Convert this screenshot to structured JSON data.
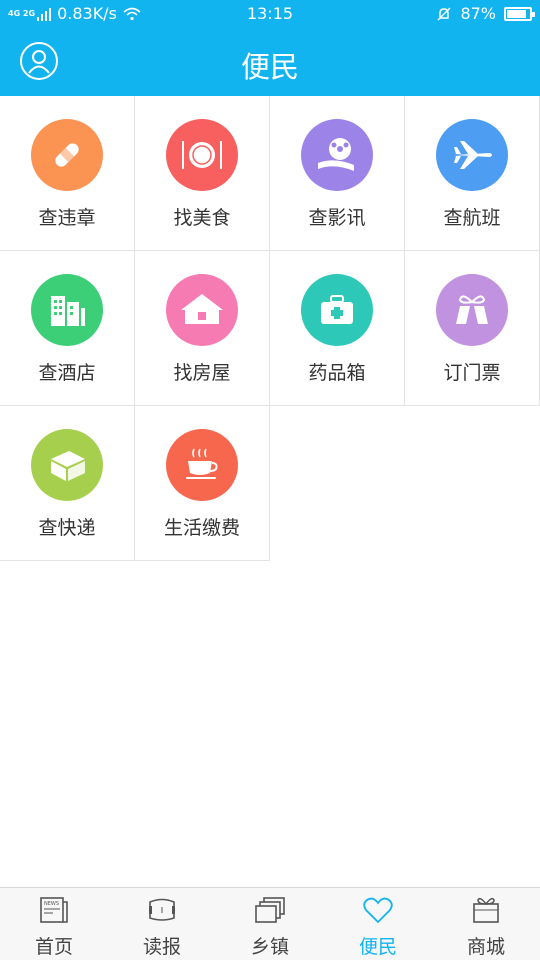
{
  "status_bar": {
    "network": "4G 2G",
    "speed": "0.83K/s",
    "time": "13:15",
    "battery": "87%",
    "battery_level": 0.87
  },
  "header": {
    "title": "便民"
  },
  "services": [
    {
      "label": "查违章",
      "icon": "bandage-icon",
      "color": "#fb9352"
    },
    {
      "label": "找美食",
      "icon": "dining-plate-icon",
      "color": "#f85f5f"
    },
    {
      "label": "查影讯",
      "icon": "film-reel-icon",
      "color": "#9b83e8"
    },
    {
      "label": "查航班",
      "icon": "airplane-icon",
      "color": "#4d9df2"
    },
    {
      "label": "查酒店",
      "icon": "hotel-building-icon",
      "color": "#3ccf78"
    },
    {
      "label": "找房屋",
      "icon": "house-icon",
      "color": "#f67bb3"
    },
    {
      "label": "药品箱",
      "icon": "medicine-box-icon",
      "color": "#2ec8b8"
    },
    {
      "label": "订门票",
      "icon": "ticket-gift-icon",
      "color": "#c192e0"
    },
    {
      "label": "查快递",
      "icon": "parcel-box-icon",
      "color": "#a7cf4e"
    },
    {
      "label": "生活缴费",
      "icon": "coffee-cup-icon",
      "color": "#f7674d"
    }
  ],
  "tabs": [
    {
      "label": "首页",
      "icon": "news-icon",
      "active": false
    },
    {
      "label": "读报",
      "icon": "newspaper-icon",
      "active": false
    },
    {
      "label": "乡镇",
      "icon": "layers-icon",
      "active": false
    },
    {
      "label": "便民",
      "icon": "heart-icon",
      "active": true
    },
    {
      "label": "商城",
      "icon": "gift-box-icon",
      "active": false
    }
  ],
  "colors": {
    "brand": "#12b4ef",
    "active_tab": "#12b4ef"
  }
}
